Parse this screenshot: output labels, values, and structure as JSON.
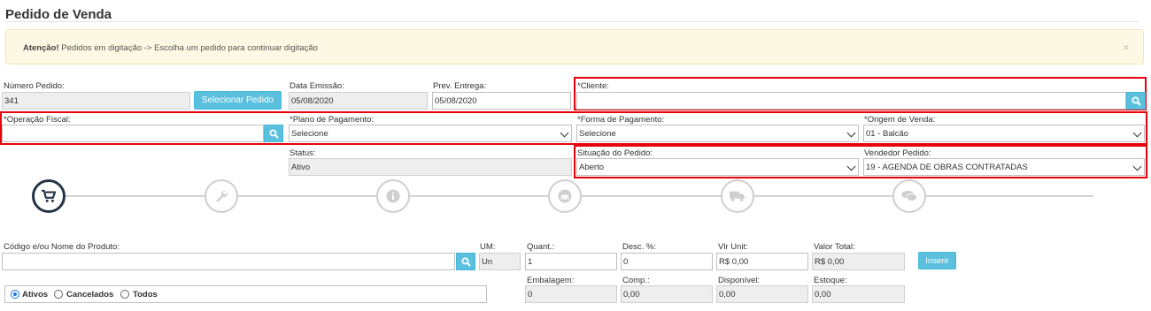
{
  "page": {
    "title": "Pedido de Venda"
  },
  "alert": {
    "strong": "Atenção!",
    "message": " Pedidos em digitação -> Escolha um pedido para continuar digitação",
    "close": "×"
  },
  "header": {
    "numero_label": "Número Pedido:",
    "numero_value": "341",
    "selecionar_label": "Selecionar Pedido",
    "data_emissao_label": "Data Emissão:",
    "data_emissao_value": "05/08/2020",
    "prev_entrega_label": "Prev. Entrega:",
    "prev_entrega_value": "05/08/2020",
    "cliente_label": "*Cliente:",
    "cliente_value": "",
    "operacao_label": "*Operação Fiscal:",
    "operacao_value": "",
    "plano_label": "*Plano de Pagamento:",
    "plano_value": "Selecione",
    "forma_label": "*Forma de Pagamento:",
    "forma_value": "Selecione",
    "origem_label": "*Origem de Venda:",
    "origem_value": "01 - Balcão",
    "status_label": "Status:",
    "status_value": "Ativo",
    "situacao_label": "Situação do Pedido:",
    "situacao_value": "Aberto",
    "vendedor_label": "Vendedor Pedido:",
    "vendedor_value": "19 - AGENDA DE OBRAS CONTRATADAS"
  },
  "steps": [
    {
      "icon": "cart-icon",
      "active": true
    },
    {
      "icon": "wrench-icon",
      "active": false
    },
    {
      "icon": "info-icon",
      "active": false
    },
    {
      "icon": "car-icon",
      "active": false
    },
    {
      "icon": "truck-icon",
      "active": false
    },
    {
      "icon": "comments-icon",
      "active": false
    }
  ],
  "product": {
    "codigo_label": "Código e/ou Nome do Produto:",
    "codigo_value": "",
    "um_label": "UM:",
    "um_value": "Un",
    "quant_label": "Quant.:",
    "quant_value": "1",
    "desc_label": "Desc. %:",
    "desc_value": "0",
    "vlr_unit_label": "Vlr Unit:",
    "vlr_unit_value": "R$ 0,00",
    "valor_total_label": "Valor Total:",
    "valor_total_value": "R$ 0,00",
    "inserir_label": "Inserir",
    "embalagem_label": "Embalagem:",
    "embalagem_value": "0",
    "comp_label": "Comp.:",
    "comp_value": "0,00",
    "disponivel_label": "Disponível:",
    "disponivel_value": "0,00",
    "estoque_label": "Estoque:",
    "estoque_value": "0,00"
  },
  "filter": {
    "options": [
      "Ativos",
      "Cancelados",
      "Todos"
    ],
    "selected": "Ativos"
  },
  "colors": {
    "accent": "#5bc0de",
    "highlight": "#e8000b",
    "alert_bg": "#fcf8e3",
    "step_active": "#243447"
  }
}
